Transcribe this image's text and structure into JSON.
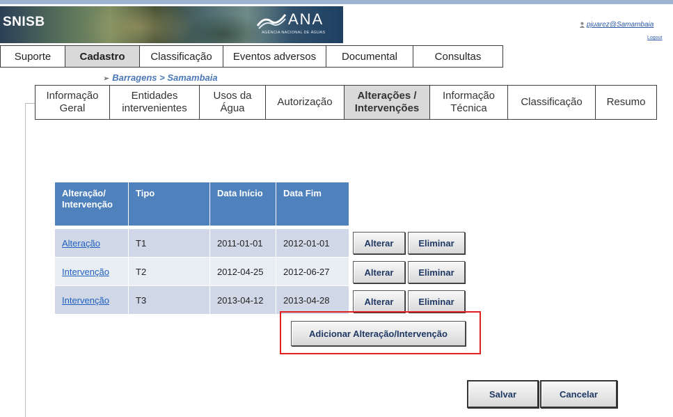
{
  "header": {
    "app_name": "SNISB",
    "logo_text": "ANA",
    "logo_subtitle": "AGÊNCIA NACIONAL DE ÁGUAS",
    "user": "pjuarez@Samambaia",
    "logout": "Logout"
  },
  "main_nav": [
    {
      "label": "Suporte",
      "active": false
    },
    {
      "label": "Cadastro",
      "active": true
    },
    {
      "label": "Classificação",
      "active": false
    },
    {
      "label": "Eventos adversos",
      "active": false
    },
    {
      "label": "Documental",
      "active": false
    },
    {
      "label": "Consultas",
      "active": false
    }
  ],
  "breadcrumb": "Barragens > Samambaia",
  "sub_nav": [
    {
      "label": "Informação Geral",
      "active": false
    },
    {
      "label": "Entidades intervenientes",
      "active": false
    },
    {
      "label": "Usos da Água",
      "active": false
    },
    {
      "label": "Autorização",
      "active": false
    },
    {
      "label": "Alterações / Intervenções",
      "active": true
    },
    {
      "label": "Informação Técnica",
      "active": false
    },
    {
      "label": "Classificação",
      "active": false
    },
    {
      "label": "Resumo",
      "active": false
    }
  ],
  "table": {
    "headers": [
      "Alteração/ Intervenção",
      "Tipo",
      "Data Início",
      "Data Fim"
    ],
    "rows": [
      {
        "name": "Alteração",
        "tipo": "T1",
        "inicio": "2011-01-01",
        "fim": "2012-01-01"
      },
      {
        "name": "Intervenção",
        "tipo": "T2",
        "inicio": "2012-04-25",
        "fim": "2012-06-27"
      },
      {
        "name": "Intervenção",
        "tipo": "T3",
        "inicio": "2013-04-12",
        "fim": "2013-04-28"
      }
    ],
    "edit_label": "Alterar",
    "delete_label": "Eliminar"
  },
  "add_button": "Adicionar Alteração/Intervenção",
  "save_button": "Salvar",
  "cancel_button": "Cancelar",
  "colors": {
    "header_blue": "#4f81bd",
    "row_dark": "#d0d8e8",
    "row_light": "#e9edf4",
    "highlight_red": "#e0201f"
  }
}
